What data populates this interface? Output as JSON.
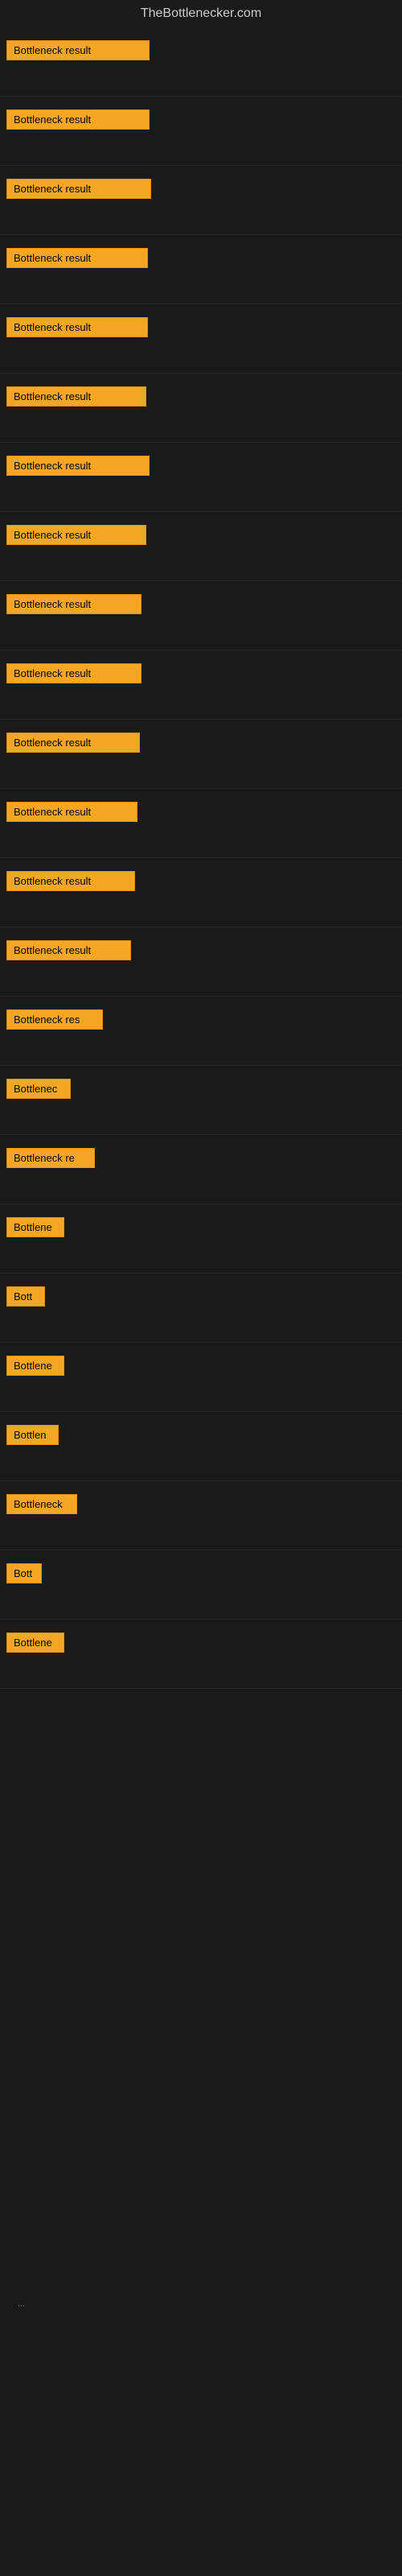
{
  "site": {
    "title": "TheBottlenecker.com"
  },
  "rows": [
    {
      "id": 1,
      "label": "Bottleneck result",
      "width": 178
    },
    {
      "id": 2,
      "label": "Bottleneck result",
      "width": 178
    },
    {
      "id": 3,
      "label": "Bottleneck result",
      "width": 180
    },
    {
      "id": 4,
      "label": "Bottleneck result",
      "width": 176
    },
    {
      "id": 5,
      "label": "Bottleneck result",
      "width": 176
    },
    {
      "id": 6,
      "label": "Bottleneck result",
      "width": 174
    },
    {
      "id": 7,
      "label": "Bottleneck result",
      "width": 178
    },
    {
      "id": 8,
      "label": "Bottleneck result",
      "width": 174
    },
    {
      "id": 9,
      "label": "Bottleneck result",
      "width": 168
    },
    {
      "id": 10,
      "label": "Bottleneck result",
      "width": 168
    },
    {
      "id": 11,
      "label": "Bottleneck result",
      "width": 166
    },
    {
      "id": 12,
      "label": "Bottleneck result",
      "width": 163
    },
    {
      "id": 13,
      "label": "Bottleneck result",
      "width": 160
    },
    {
      "id": 14,
      "label": "Bottleneck result",
      "width": 155
    },
    {
      "id": 15,
      "label": "Bottleneck res",
      "width": 120
    },
    {
      "id": 16,
      "label": "Bottlenec",
      "width": 80
    },
    {
      "id": 17,
      "label": "Bottleneck re",
      "width": 110
    },
    {
      "id": 18,
      "label": "Bottlene",
      "width": 72
    },
    {
      "id": 19,
      "label": "Bott",
      "width": 48
    },
    {
      "id": 20,
      "label": "Bottlene",
      "width": 72
    },
    {
      "id": 21,
      "label": "Bottlen",
      "width": 65
    },
    {
      "id": 22,
      "label": "Bottleneck",
      "width": 88
    },
    {
      "id": 23,
      "label": "Bott",
      "width": 44
    },
    {
      "id": 24,
      "label": "Bottlene",
      "width": 72
    }
  ],
  "ellipsis": "..."
}
